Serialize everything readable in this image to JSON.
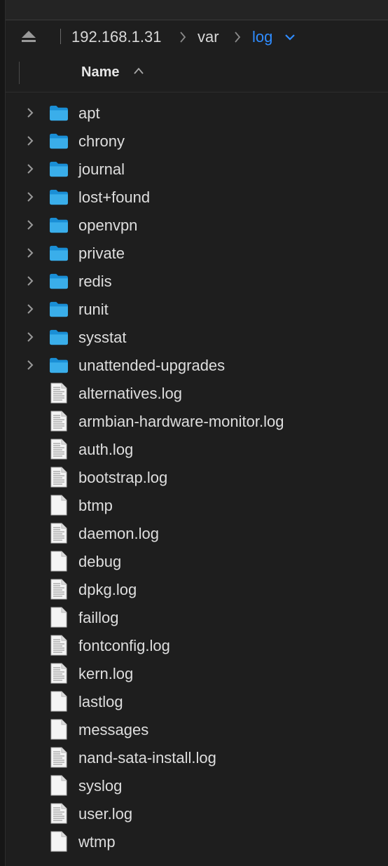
{
  "pathbar": {
    "eject_icon": "eject-icon",
    "crumbs": [
      "192.168.1.31",
      "var",
      "log"
    ],
    "accent_color": "#2f8cff"
  },
  "header": {
    "name_label": "Name",
    "sort": "ascending"
  },
  "items": [
    {
      "name": "apt",
      "type": "folder"
    },
    {
      "name": "chrony",
      "type": "folder"
    },
    {
      "name": "journal",
      "type": "folder"
    },
    {
      "name": "lost+found",
      "type": "folder"
    },
    {
      "name": "openvpn",
      "type": "folder"
    },
    {
      "name": "private",
      "type": "folder"
    },
    {
      "name": "redis",
      "type": "folder"
    },
    {
      "name": "runit",
      "type": "folder"
    },
    {
      "name": "sysstat",
      "type": "folder"
    },
    {
      "name": "unattended-upgrades",
      "type": "folder"
    },
    {
      "name": "alternatives.log",
      "type": "text-file"
    },
    {
      "name": "armbian-hardware-monitor.log",
      "type": "text-file"
    },
    {
      "name": "auth.log",
      "type": "text-file"
    },
    {
      "name": "bootstrap.log",
      "type": "text-file"
    },
    {
      "name": "btmp",
      "type": "file"
    },
    {
      "name": "daemon.log",
      "type": "text-file"
    },
    {
      "name": "debug",
      "type": "file"
    },
    {
      "name": "dpkg.log",
      "type": "text-file"
    },
    {
      "name": "faillog",
      "type": "file"
    },
    {
      "name": "fontconfig.log",
      "type": "text-file"
    },
    {
      "name": "kern.log",
      "type": "text-file"
    },
    {
      "name": "lastlog",
      "type": "file"
    },
    {
      "name": "messages",
      "type": "file"
    },
    {
      "name": "nand-sata-install.log",
      "type": "text-file"
    },
    {
      "name": "syslog",
      "type": "file"
    },
    {
      "name": "user.log",
      "type": "text-file"
    },
    {
      "name": "wtmp",
      "type": "file"
    }
  ]
}
